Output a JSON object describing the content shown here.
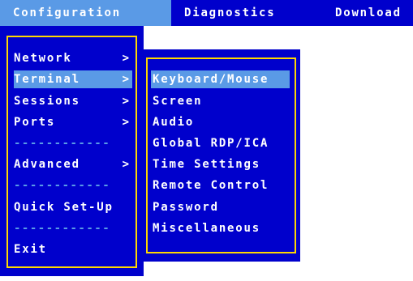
{
  "menubar": {
    "tabs": [
      {
        "label": "Configuration"
      },
      {
        "label": "Diagnostics"
      },
      {
        "label": "Download"
      }
    ]
  },
  "main_menu": {
    "items": [
      {
        "label": "Network",
        "arrow": ">"
      },
      {
        "label": "Terminal",
        "arrow": ">"
      },
      {
        "label": "Sessions",
        "arrow": ">"
      },
      {
        "label": "Ports",
        "arrow": ">"
      },
      {
        "label": "Advanced",
        "arrow": ">"
      },
      {
        "label": "Quick Set-Up"
      },
      {
        "label": "Exit"
      }
    ],
    "separator": "------------"
  },
  "submenu": {
    "items": [
      {
        "label": "Keyboard/Mouse"
      },
      {
        "label": "Screen"
      },
      {
        "label": "Audio"
      },
      {
        "label": "Global RDP/ICA"
      },
      {
        "label": "Time Settings"
      },
      {
        "label": "Remote Control"
      },
      {
        "label": "Password"
      },
      {
        "label": "Miscellaneous"
      }
    ]
  },
  "colors": {
    "menu_background": "#0000cc",
    "highlight": "#5a9ae6",
    "border": "#ffd700",
    "text": "#ffffff"
  }
}
